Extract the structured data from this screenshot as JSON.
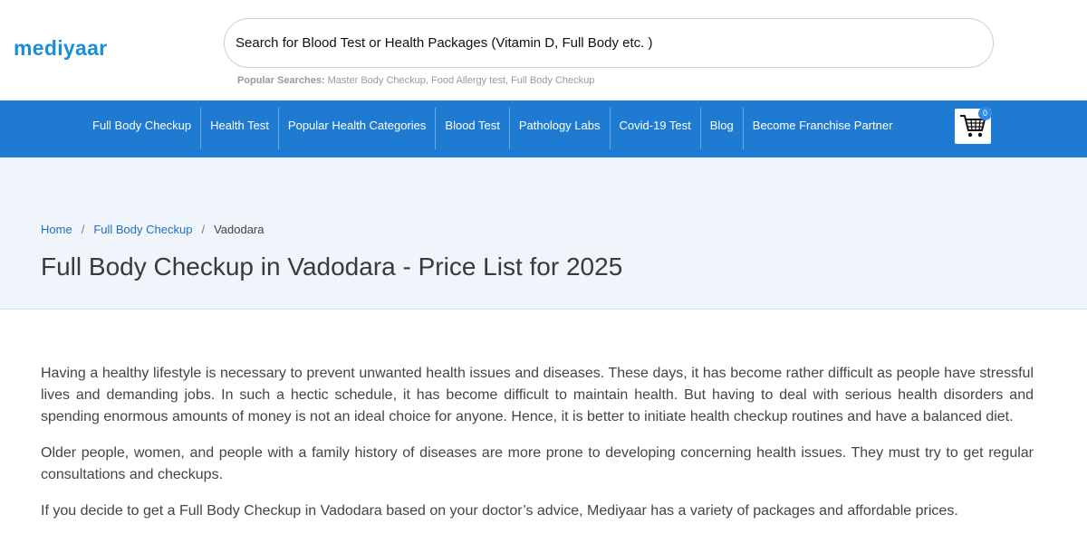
{
  "header": {
    "logo": "mediyaar",
    "search": {
      "placeholder": "Search for Blood Test or Health Packages (Vitamin D, Full Body etc. )",
      "value": ""
    },
    "popular_label": "Popular Searches:",
    "popular_items": [
      "Master Body Checkup",
      "Food Allergy test",
      "Full Body Checkup"
    ]
  },
  "nav": {
    "items": [
      "Full Body Checkup",
      "Health Test",
      "Popular Health Categories",
      "Blood Test",
      "Pathology Labs",
      "Covid-19 Test",
      "Blog",
      "Become Franchise Partner"
    ],
    "cart_icon": "shopping-cart-icon",
    "cart_count": "0"
  },
  "banner": {
    "breadcrumb": {
      "home": "Home",
      "sep": "/",
      "category": "Full Body Checkup",
      "current": "Vadodara"
    },
    "title": "Full Body Checkup in Vadodara - Price List for 2025"
  },
  "content": {
    "paragraphs": [
      "Having a healthy lifestyle is necessary to prevent unwanted health issues and diseases. These days, it has become rather difficult as people have stressful lives and demanding jobs. In such a hectic schedule, it has become difficult to maintain health. But having to deal with serious health disorders and spending enormous amounts of money is not an ideal choice for anyone. Hence, it is better to initiate health checkup routines and have a balanced diet.",
      "Older people, women, and people with a family history of diseases are more prone to developing concerning health issues. They must try to get regular consultations and checkups.",
      "If you decide to get a Full Body Checkup in Vadodara based on your doctor’s advice, Mediyaar has a variety of packages and affordable prices."
    ]
  },
  "colors": {
    "brand": "#1a8fd8",
    "nav_background": "#1f7bd1",
    "banner_background": "#eff5fb",
    "link": "#1f6fc0",
    "badge": "#2d8ae5"
  }
}
